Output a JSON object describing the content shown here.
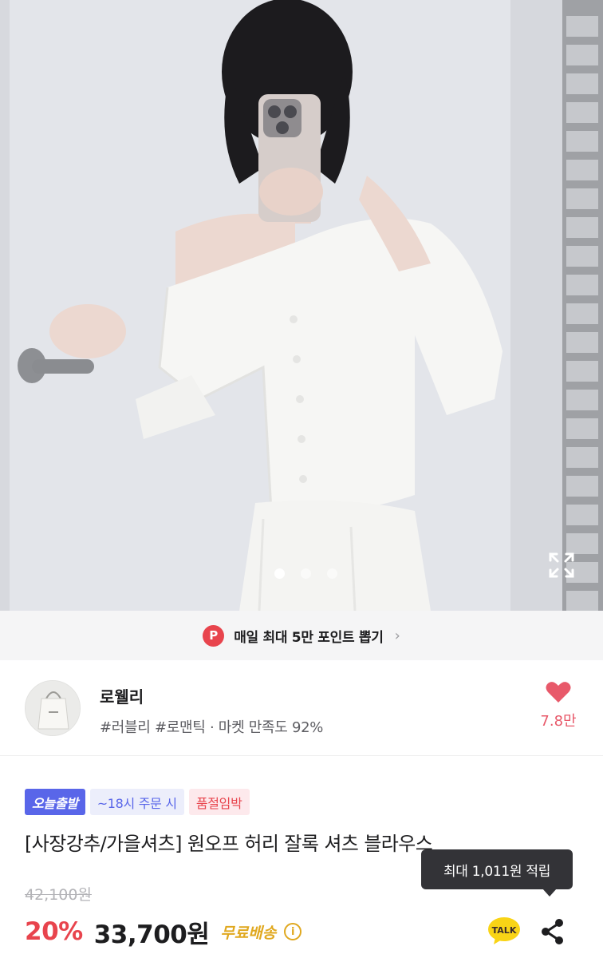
{
  "gallery": {
    "slide_count": 3,
    "active_slide": 1,
    "expand_icon": "expand-icon",
    "image_subject": "product-photo"
  },
  "promo": {
    "badge": "P",
    "text": "매일 최대 5만 포인트 뽑기",
    "chevron_icon": "chevron-right-icon"
  },
  "shop": {
    "name": "로웰리",
    "tags": "#러블리 #로맨틱 · 마켓 만족도 92%",
    "avatar_icon": "shop-bag-logo",
    "like_icon": "heart-icon",
    "like_count": "7.8만"
  },
  "product": {
    "badges": {
      "today": "오늘출발",
      "order_time": "~18시 주문 시",
      "soldout": "품절임박"
    },
    "title": "[사장강추/가을셔츠] 원오프 허리 잘록 셔츠 블라우스",
    "original_price": "42,100원",
    "discount": "20%",
    "price": "33,700원",
    "shipping": "무료배송",
    "info_icon": "info-icon"
  },
  "actions": {
    "tooltip": "최대 1,011원 적립",
    "kakao_label": "TALK",
    "share_icon": "share-icon"
  },
  "colors": {
    "accent_red": "#e8444d",
    "badge_blue": "#5966e9",
    "shipping_gold": "#e0a81f",
    "like_pink": "#e8596a"
  }
}
